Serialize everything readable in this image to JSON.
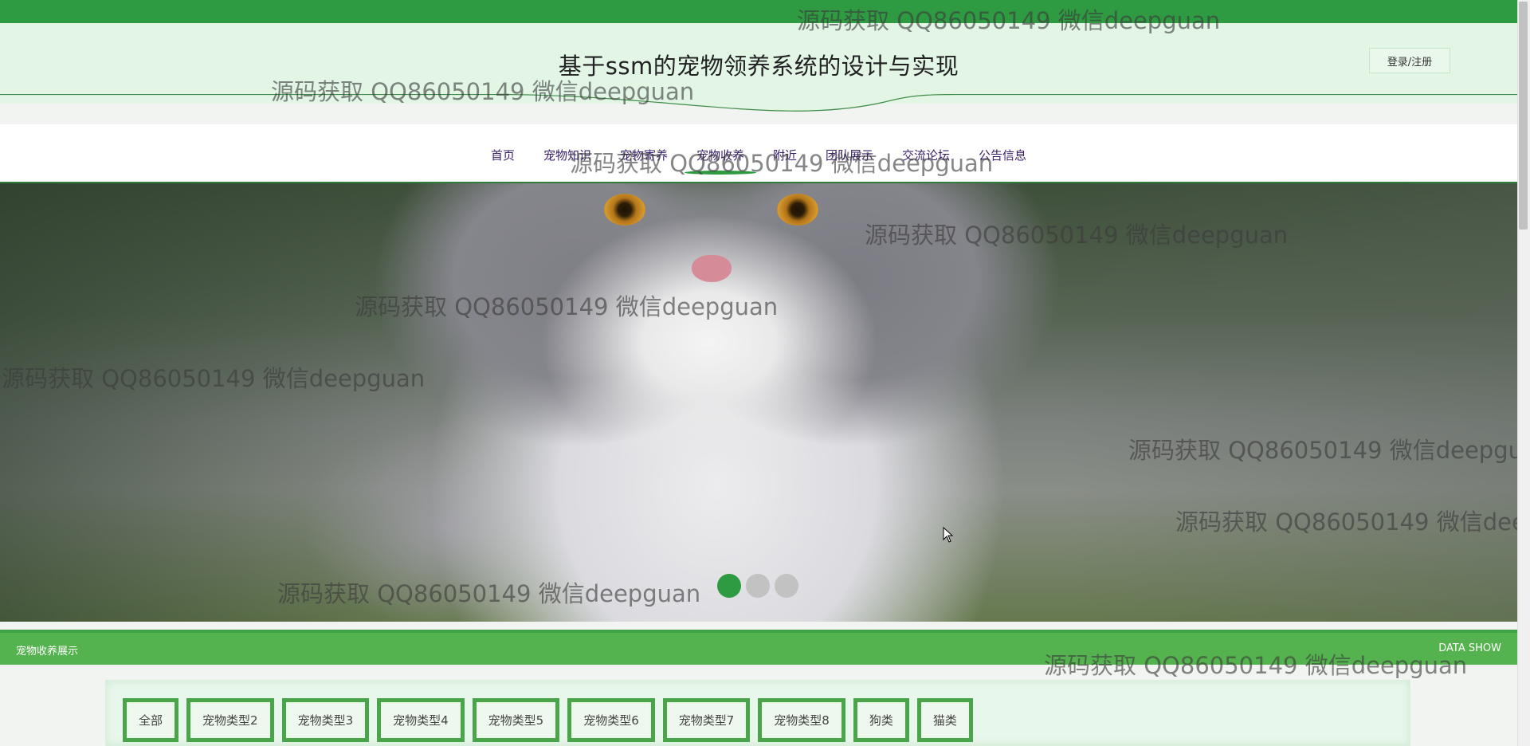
{
  "header": {
    "site_title": "基于ssm的宠物领养系统的设计与实现",
    "login_label": "登录/注册"
  },
  "nav": {
    "items": [
      {
        "label": "首页"
      },
      {
        "label": "宠物知识"
      },
      {
        "label": "宠物寄养"
      },
      {
        "label": "宠物收养",
        "active": true
      },
      {
        "label": "附近"
      },
      {
        "label": "团队展示"
      },
      {
        "label": "交流论坛"
      },
      {
        "label": "公告信息"
      }
    ]
  },
  "carousel": {
    "slide_count": 3,
    "active_index": 0
  },
  "section": {
    "title": "宠物收养展示",
    "subtitle": "DATA SHOW"
  },
  "filters": [
    "全部",
    "宠物类型2",
    "宠物类型3",
    "宠物类型4",
    "宠物类型5",
    "宠物类型6",
    "宠物类型7",
    "宠物类型8",
    "狗类",
    "猫类"
  ],
  "watermark": {
    "text": "源码获取 QQ86050149 微信deepguan"
  },
  "colors": {
    "brand_green": "#2e9a41",
    "section_green": "#54b34e",
    "header_bg": "#e3f6e6",
    "nav_text": "#3a1f6b"
  }
}
